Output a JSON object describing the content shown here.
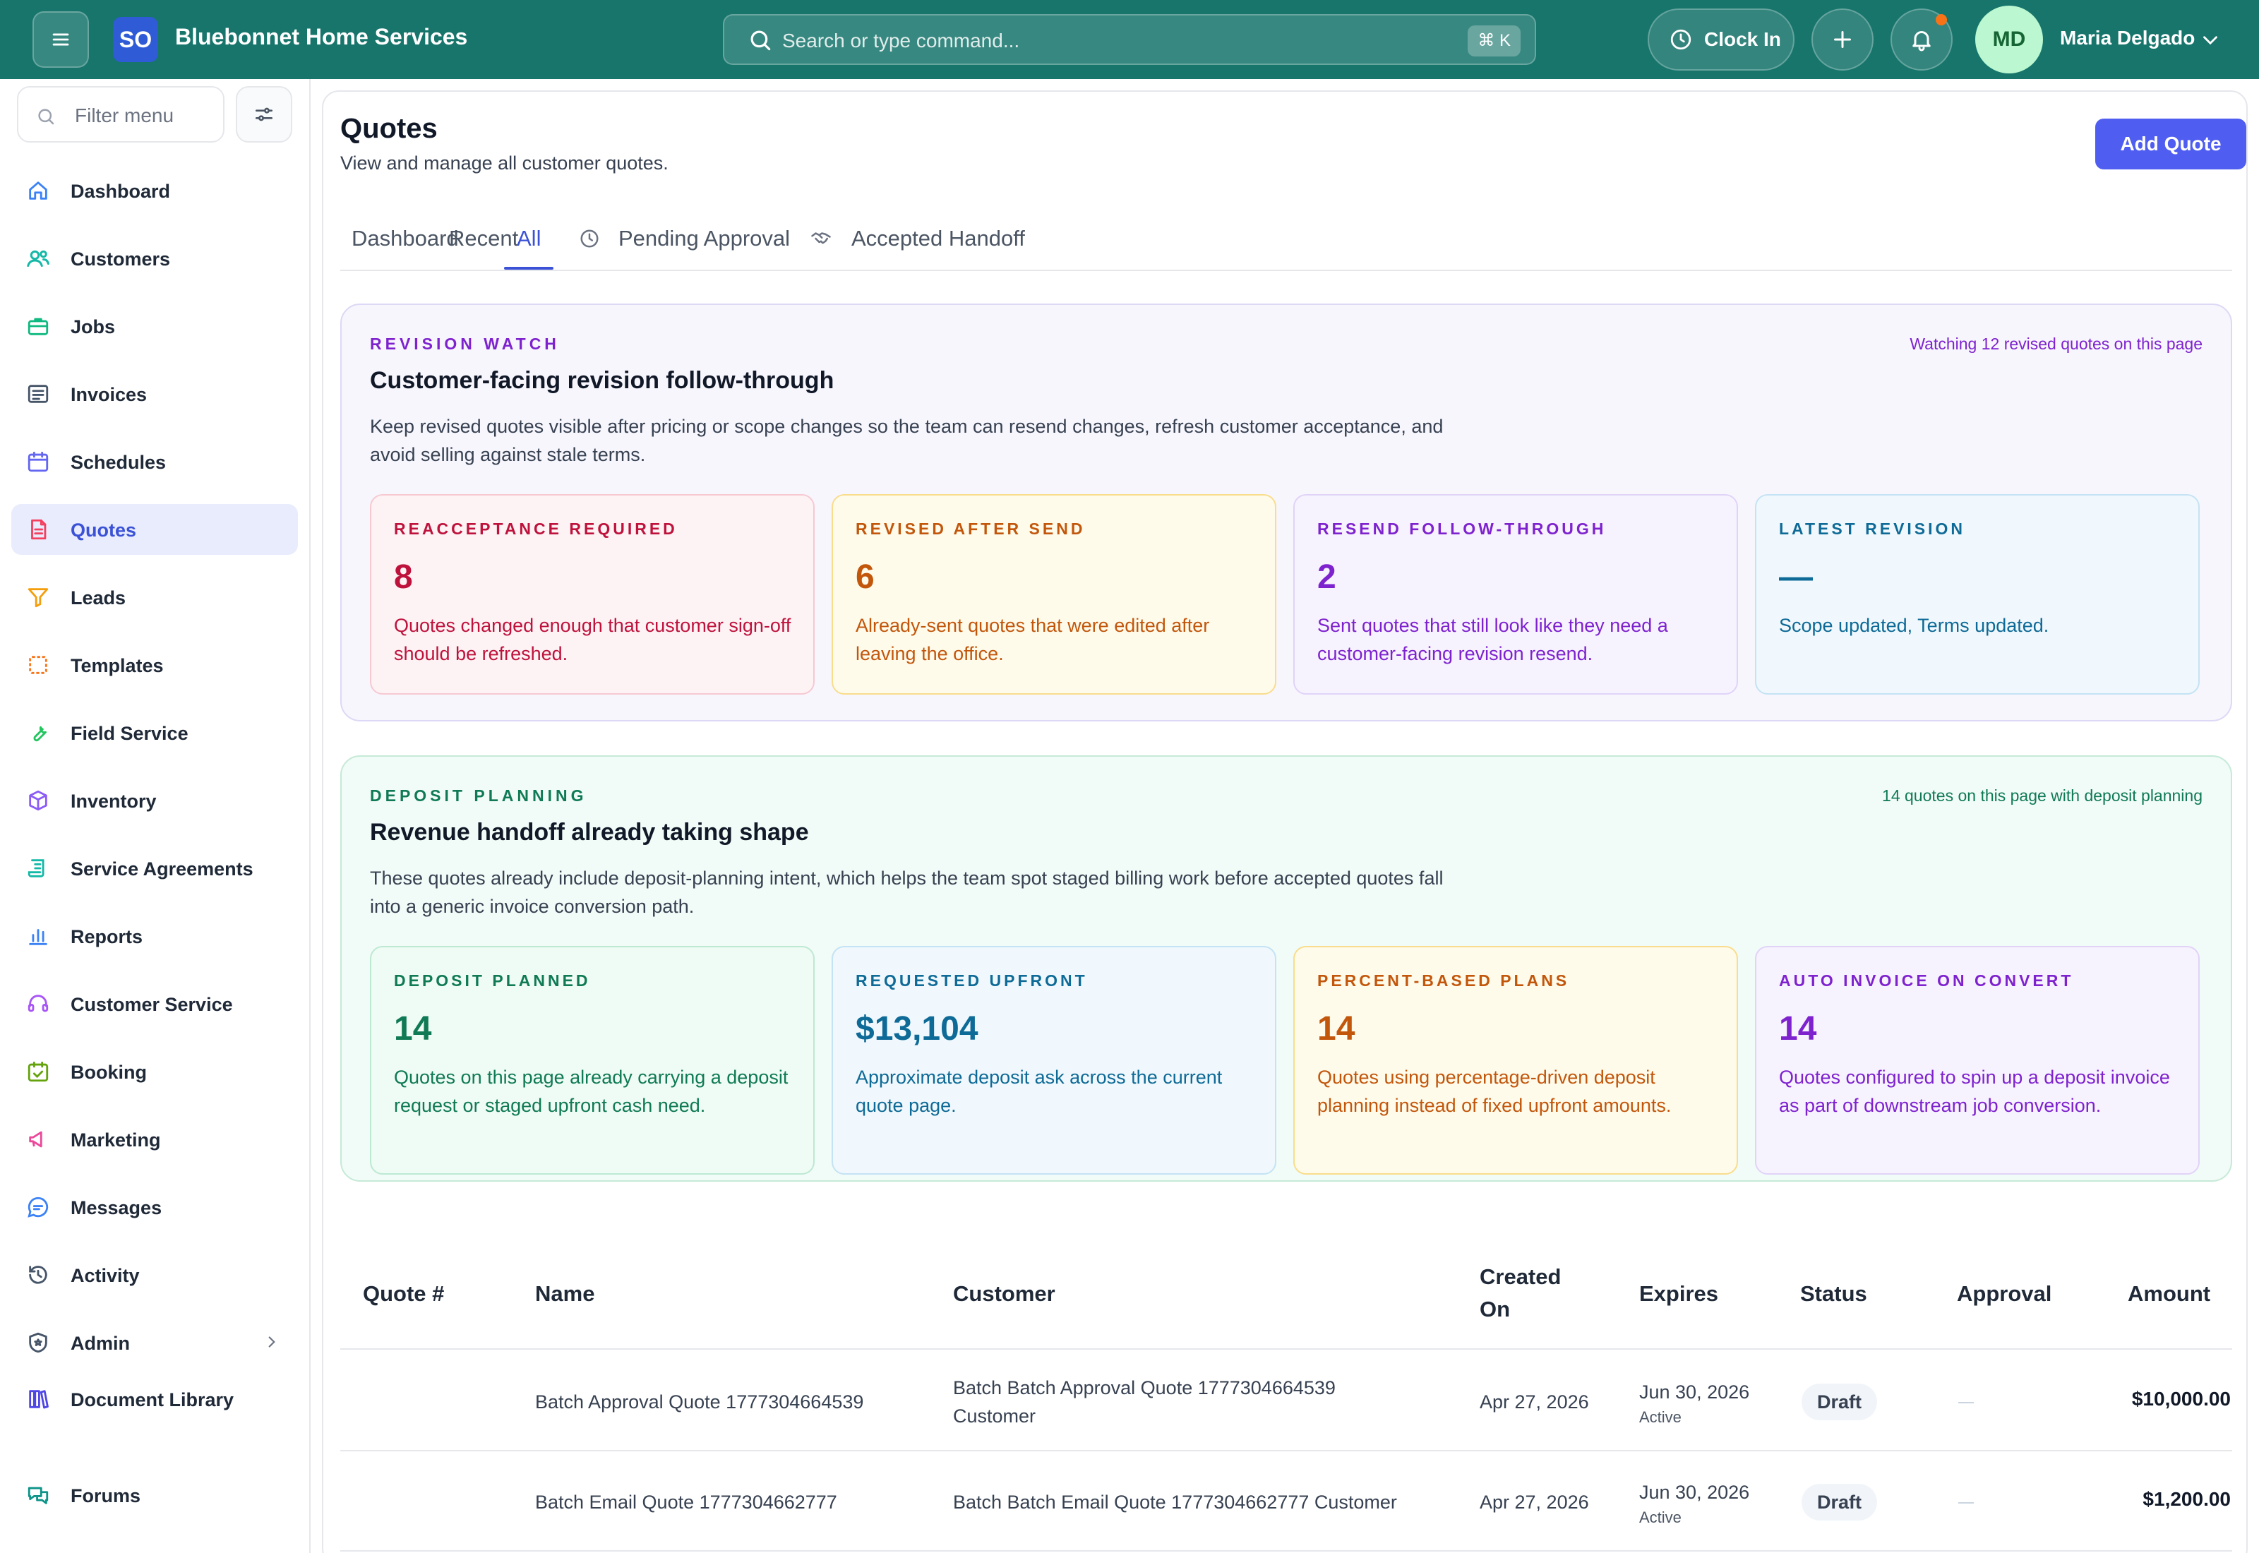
{
  "header": {
    "logo_text": "SO",
    "brand": "Bluebonnet Home Services",
    "search_placeholder": "Search or type command...",
    "search_shortcut": "⌘ K",
    "clock_in_label": "Clock In",
    "user_initials": "MD",
    "user_name": "Maria Delgado"
  },
  "sidebar": {
    "filter_placeholder": "Filter menu",
    "items": [
      {
        "label": "Dashboard",
        "icon": "home-icon"
      },
      {
        "label": "Customers",
        "icon": "users-icon"
      },
      {
        "label": "Jobs",
        "icon": "briefcase-icon"
      },
      {
        "label": "Invoices",
        "icon": "invoice-icon"
      },
      {
        "label": "Schedules",
        "icon": "calendar-icon"
      },
      {
        "label": "Quotes",
        "icon": "quote-document-icon",
        "active": true
      },
      {
        "label": "Leads",
        "icon": "funnel-icon"
      },
      {
        "label": "Templates",
        "icon": "template-icon"
      },
      {
        "label": "Field Service",
        "icon": "wrench-icon"
      },
      {
        "label": "Inventory",
        "icon": "box-icon"
      },
      {
        "label": "Service Agreements",
        "icon": "scroll-icon"
      },
      {
        "label": "Reports",
        "icon": "bar-chart-icon"
      },
      {
        "label": "Customer Service",
        "icon": "headset-icon"
      },
      {
        "label": "Booking",
        "icon": "calendar-check-icon"
      },
      {
        "label": "Marketing",
        "icon": "megaphone-icon"
      },
      {
        "label": "Messages",
        "icon": "chat-icon"
      },
      {
        "label": "Activity",
        "icon": "history-icon"
      },
      {
        "label": "Admin",
        "icon": "shield-icon"
      },
      {
        "label": "Document Library",
        "icon": "library-icon"
      },
      {
        "label": "Forums",
        "icon": "forum-icon"
      }
    ]
  },
  "page": {
    "title": "Quotes",
    "subtitle": "View and manage all customer quotes.",
    "add_button": "Add Quote",
    "tabs": [
      "Dashboard",
      "Recent",
      "All",
      "Pending Approval",
      "Accepted Handoff"
    ],
    "active_tab": "All"
  },
  "revision_panel": {
    "eyebrow": "REVISION WATCH",
    "note": "Watching 12 revised quotes on this page",
    "title": "Customer-facing revision follow-through",
    "description": "Keep revised quotes visible after pricing or scope changes so the team can resend changes, refresh customer acceptance, and avoid selling against stale terms.",
    "cards": [
      {
        "title": "REACCEPTANCE REQUIRED",
        "value": "8",
        "desc": "Quotes changed enough that customer sign-off should be refreshed.",
        "color": "#be123c",
        "bg": "#fdf2f4",
        "border": "#f6c9d2"
      },
      {
        "title": "REVISED AFTER SEND",
        "value": "6",
        "desc": "Already-sent quotes that were edited after leaving the office.",
        "color": "#c2570c",
        "bg": "#fffbeb",
        "border": "#f9dd8c"
      },
      {
        "title": "RESEND FOLLOW-THROUGH",
        "value": "2",
        "desc": "Sent quotes that still look like they need a customer-facing revision resend.",
        "color": "#7e22ce",
        "bg": "#f7f3fe",
        "border": "#e1d3f8"
      },
      {
        "title": "LATEST REVISION",
        "value": "—",
        "desc": "Scope updated, Terms updated.",
        "color": "#0e6a96",
        "bg": "#f0f8fd",
        "border": "#c4e3f4"
      }
    ]
  },
  "deposit_panel": {
    "eyebrow": "DEPOSIT PLANNING",
    "note": "14 quotes on this page with deposit planning",
    "title": "Revenue handoff already taking shape",
    "description": "These quotes already include deposit-planning intent, which helps the team spot staged billing work before accepted quotes fall into a generic invoice conversion path.",
    "cards": [
      {
        "title": "DEPOSIT PLANNED",
        "value": "14",
        "desc": "Quotes on this page already carrying a deposit request or staged upfront cash need.",
        "color": "#0f7a55",
        "bg": "#effbf5",
        "border": "#bde9d3"
      },
      {
        "title": "REQUESTED UPFRONT",
        "value": "$13,104",
        "desc": "Approximate deposit ask across the current quote page.",
        "color": "#0e6a96",
        "bg": "#f0f8fd",
        "border": "#c4e3f4"
      },
      {
        "title": "PERCENT-BASED PLANS",
        "value": "14",
        "desc": "Quotes using percentage-driven deposit planning instead of fixed upfront amounts.",
        "color": "#c2570c",
        "bg": "#fffbeb",
        "border": "#f9dd8c"
      },
      {
        "title": "AUTO INVOICE ON CONVERT",
        "value": "14",
        "desc": "Quotes configured to spin up a deposit invoice as part of downstream job conversion.",
        "color": "#7e22ce",
        "bg": "#f7f3fe",
        "border": "#e1d3f8"
      }
    ]
  },
  "table": {
    "headers": {
      "quote_no": "Quote #",
      "name": "Name",
      "customer": "Customer",
      "created_on": "Created On",
      "expires": "Expires",
      "status": "Status",
      "approval": "Approval",
      "amount": "Amount"
    },
    "rows": [
      {
        "quote_no": "",
        "name": "Batch Approval Quote 1777304664539",
        "customer": "Batch Batch Approval Quote 1777304664539 Customer",
        "created": "Apr 27, 2026",
        "expires": "Jun 30, 2026",
        "expires_sub": "Active",
        "status": "Draft",
        "approval": "—",
        "amount": "$10,000.00"
      },
      {
        "quote_no": "",
        "name": "Batch Email Quote 1777304662777",
        "customer": "Batch Batch Email Quote 1777304662777 Customer",
        "created": "Apr 27, 2026",
        "expires": "Jun 30, 2026",
        "expires_sub": "Active",
        "status": "Draft",
        "approval": "—",
        "amount": "$1,200.00"
      }
    ]
  },
  "colors": {
    "topbar": "#17756c",
    "accent": "#4f5ef0",
    "active_nav_bg": "#e8ecfd"
  }
}
